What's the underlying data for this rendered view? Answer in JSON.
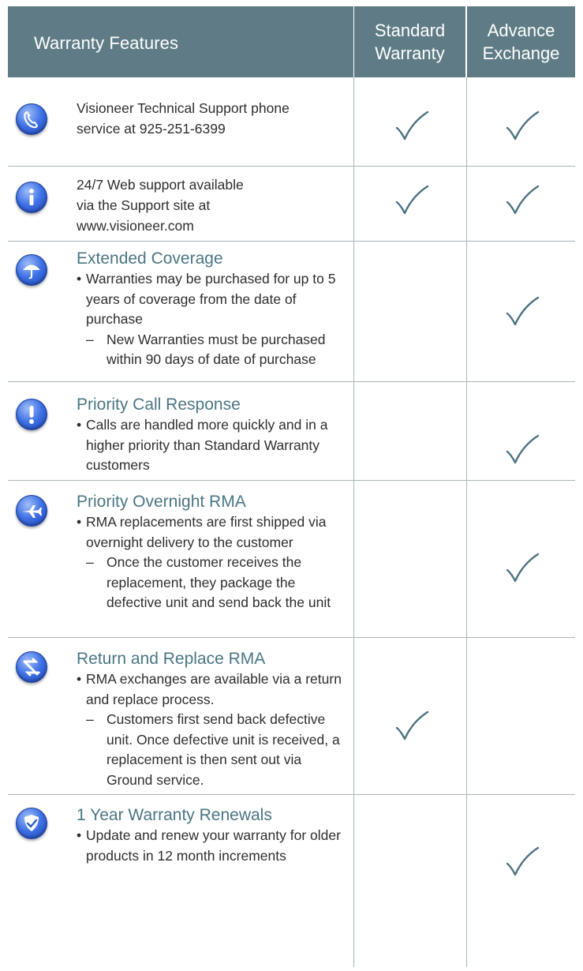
{
  "header": {
    "features_label": "Warranty Features",
    "standard_line1": "Standard",
    "standard_line2": "Warranty",
    "advance_line1": "Advance",
    "advance_line2": "Exchange"
  },
  "colors": {
    "header_bg": "#5f7c86",
    "title_text": "#4a7684",
    "check": "#4b7280",
    "icon_blue": "#3f72e6"
  },
  "rows": [
    {
      "icon": "phone-icon",
      "lines": [
        "Visioneer Technical Support phone",
        "service at 925-251-6399"
      ],
      "standard": true,
      "advance": true
    },
    {
      "icon": "info-icon",
      "lines": [
        "24/7 Web support available",
        "via the Support site at",
        "www.visioneer.com"
      ],
      "standard": true,
      "advance": true
    },
    {
      "icon": "umbrella-icon",
      "title": "Extended Coverage",
      "bullets": [
        {
          "text": "Warranties may be purchased for up to 5 years of coverage from the date of purchase",
          "sub": [
            "New Warranties must be purchased within 90 days of date of purchase"
          ]
        }
      ],
      "standard": false,
      "advance": true
    },
    {
      "icon": "exclamation-icon",
      "title": "Priority Call Response",
      "bullets": [
        {
          "text": "Calls are handled more quickly and in a higher priority than Standard Warranty customers",
          "sub": []
        }
      ],
      "standard": false,
      "advance": true
    },
    {
      "icon": "airplane-icon",
      "title": "Priority Overnight RMA",
      "bullets": [
        {
          "text": "RMA replacements are first shipped via overnight delivery to the customer",
          "sub": [
            "Once the customer receives the replacement, they package the defective unit and send back the unit"
          ]
        }
      ],
      "standard": false,
      "advance": true
    },
    {
      "icon": "swap-arrows-icon",
      "title": "Return and Replace RMA",
      "bullets": [
        {
          "text": "RMA exchanges are available via a return and replace process.",
          "sub": [
            "Customers first send back defective unit. Once defective unit is received, a replacement is then sent out via Ground service."
          ]
        }
      ],
      "standard": true,
      "advance": false
    },
    {
      "icon": "shield-check-icon",
      "title": "1 Year Warranty Renewals",
      "bullets": [
        {
          "text": "Update and renew your warranty for older products in 12 month increments",
          "sub": []
        }
      ],
      "standard": false,
      "advance": true
    }
  ]
}
